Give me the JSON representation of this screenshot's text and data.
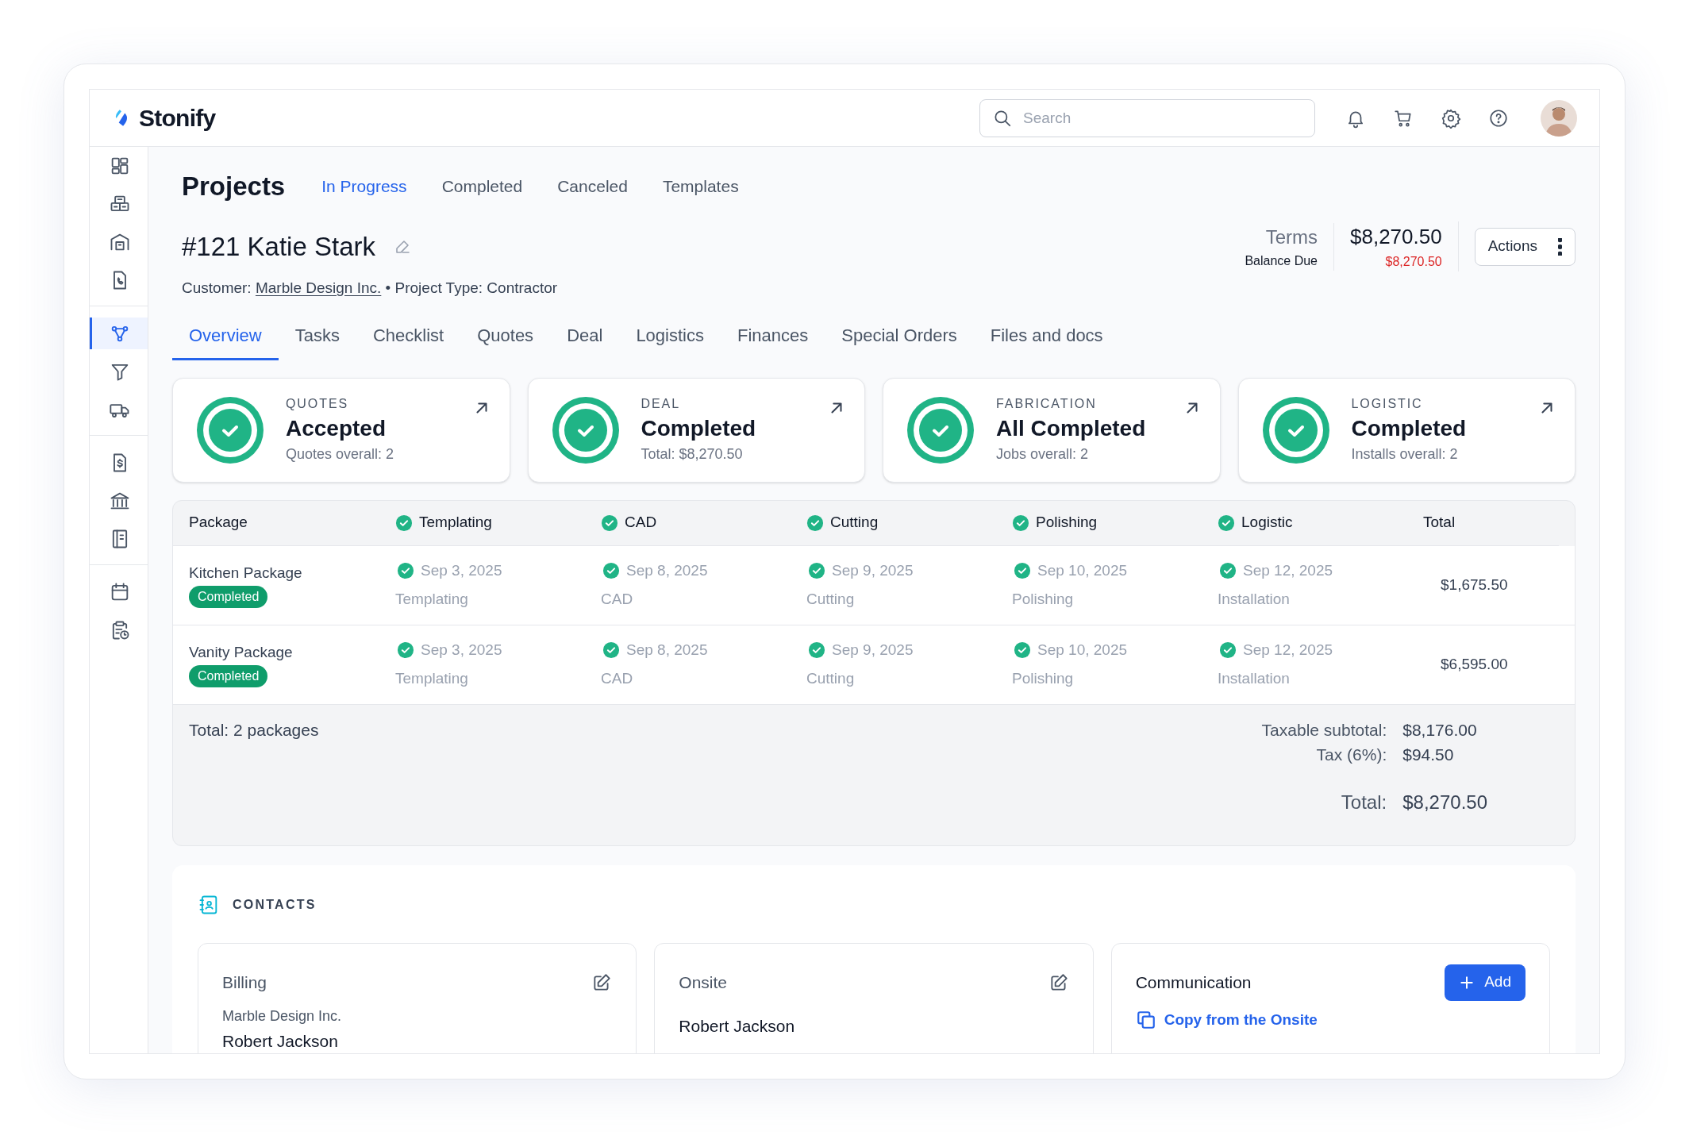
{
  "app": {
    "name": "Stonify"
  },
  "search": {
    "placeholder": "Search"
  },
  "sidebar": {
    "groups": [
      [
        {
          "selected": false
        },
        {
          "selected": false
        },
        {
          "selected": false
        },
        {
          "selected": false
        }
      ],
      [
        {
          "selected": true
        },
        {
          "selected": false
        },
        {
          "selected": false
        }
      ],
      [
        {
          "selected": false
        },
        {
          "selected": false
        },
        {
          "selected": false
        }
      ],
      [
        {
          "selected": false
        },
        {
          "selected": false
        }
      ]
    ]
  },
  "page": {
    "title": "Projects",
    "nav": [
      {
        "label": "In Progress",
        "selected": true
      },
      {
        "label": "Completed",
        "selected": false
      },
      {
        "label": "Canceled",
        "selected": false
      },
      {
        "label": "Templates",
        "selected": false
      }
    ]
  },
  "project": {
    "title": "#121 Katie Stark",
    "customer_label": "Customer:",
    "customer": "Marble Design Inc.",
    "rest": "• Project Type: Contractor"
  },
  "summary": {
    "terms_label": "Terms",
    "balance_label": "Balance Due",
    "amount": "$8,270.50",
    "balance": "$8,270.50",
    "actions": "Actions"
  },
  "tabs": [
    {
      "label": "Overview",
      "selected": true
    },
    {
      "label": "Tasks",
      "selected": false
    },
    {
      "label": "Checklist",
      "selected": false
    },
    {
      "label": "Quotes",
      "selected": false
    },
    {
      "label": "Deal",
      "selected": false
    },
    {
      "label": "Logistics",
      "selected": false
    },
    {
      "label": "Finances",
      "selected": false
    },
    {
      "label": "Special Orders",
      "selected": false
    },
    {
      "label": "Files and docs",
      "selected": false
    }
  ],
  "cards": [
    {
      "category": "QUOTES",
      "status": "Accepted",
      "detail": "Quotes overall: 2"
    },
    {
      "category": "DEAL",
      "status": "Completed",
      "detail": "Total: $8,270.50"
    },
    {
      "category": "FABRICATION",
      "status": "All Completed",
      "detail": "Jobs overall: 2"
    },
    {
      "category": "LOGISTIC",
      "status": "Completed",
      "detail": "Installs overall: 2"
    }
  ],
  "table": {
    "columns": [
      {
        "label": "Package",
        "done": false
      },
      {
        "label": "Templating",
        "done": true
      },
      {
        "label": "CAD",
        "done": true
      },
      {
        "label": "Cutting",
        "done": true
      },
      {
        "label": "Polishing",
        "done": true
      },
      {
        "label": "Logistic",
        "done": true
      },
      {
        "label": "Total",
        "done": false
      }
    ],
    "rows": [
      {
        "name": "Kitchen Package",
        "badge": "Completed",
        "stages": [
          {
            "date": "Sep 3, 2025",
            "label": "Templating",
            "done": true
          },
          {
            "date": "Sep 8, 2025",
            "label": "CAD",
            "done": true
          },
          {
            "date": "Sep 9, 2025",
            "label": "Cutting",
            "done": true
          },
          {
            "date": "Sep 10, 2025",
            "label": "Polishing",
            "done": true
          },
          {
            "date": "Sep 12, 2025",
            "label": "Installation",
            "done": true
          }
        ],
        "total": "$1,675.50"
      },
      {
        "name": "Vanity Package",
        "badge": "Completed",
        "stages": [
          {
            "date": "Sep 3, 2025",
            "label": "Templating",
            "done": true
          },
          {
            "date": "Sep 8, 2025",
            "label": "CAD",
            "done": true
          },
          {
            "date": "Sep 9, 2025",
            "label": "Cutting",
            "done": true
          },
          {
            "date": "Sep 10, 2025",
            "label": "Polishing",
            "done": true
          },
          {
            "date": "Sep 12, 2025",
            "label": "Installation",
            "done": true
          }
        ],
        "total": "$6,595.00"
      }
    ],
    "footer": {
      "count": "Total: 2 packages",
      "lines": [
        {
          "label": "Taxable subtotal:",
          "value": "$8,176.00"
        },
        {
          "label": "Tax (6%):",
          "value": "$94.50"
        }
      ],
      "total_label": "Total:",
      "total": "$8,270.50"
    }
  },
  "contacts": {
    "title": "CONTACTS",
    "cards": [
      {
        "kind": "editable",
        "title": "Billing",
        "subtitle": "Marble Design Inc.",
        "name": "Robert Jackson"
      },
      {
        "kind": "editable",
        "title": "Onsite",
        "name": "Robert Jackson"
      },
      {
        "kind": "communication",
        "title": "Communication",
        "button": "Add",
        "link": "Copy from the Onsite"
      }
    ]
  }
}
